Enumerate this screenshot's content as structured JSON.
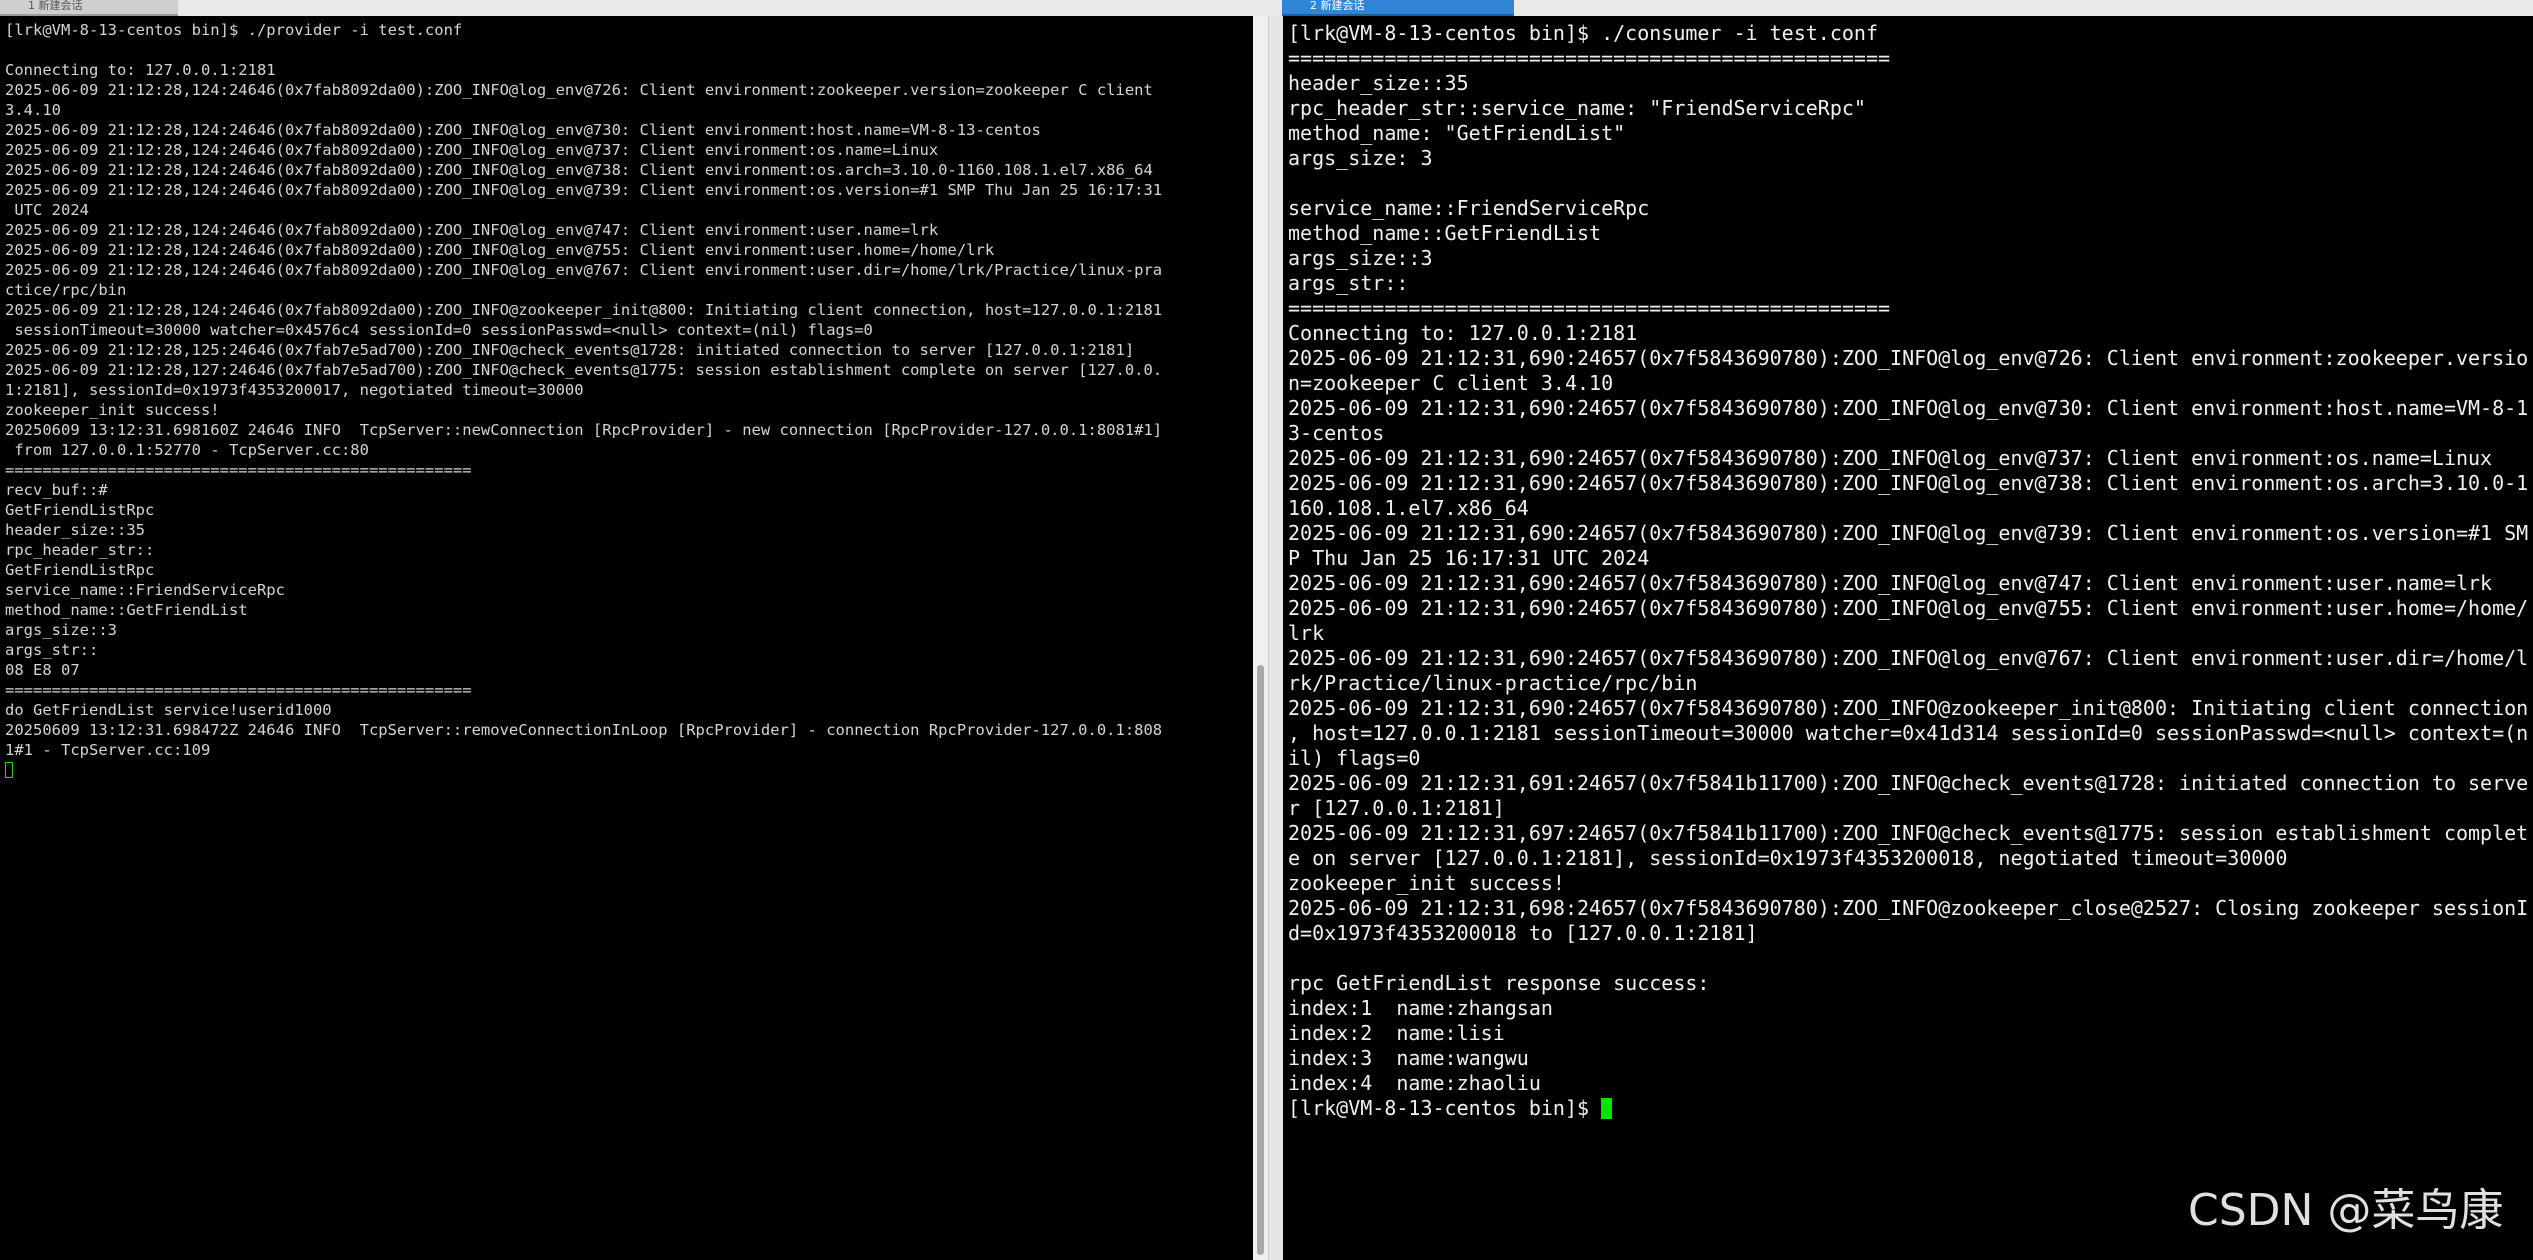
{
  "tabs": [
    {
      "label": "1 新建会话"
    },
    {
      "label": "2 新建会话"
    }
  ],
  "left_terminal": {
    "prompt_command": "[lrk@VM-8-13-centos bin]$ ./provider -i test.conf",
    "lines": [
      " ",
      "Connecting to: 127.0.0.1:2181",
      "2025-06-09 21:12:28,124:24646(0x7fab8092da00):ZOO_INFO@log_env@726: Client environment:zookeeper.version=zookeeper C client",
      "3.4.10",
      "2025-06-09 21:12:28,124:24646(0x7fab8092da00):ZOO_INFO@log_env@730: Client environment:host.name=VM-8-13-centos",
      "2025-06-09 21:12:28,124:24646(0x7fab8092da00):ZOO_INFO@log_env@737: Client environment:os.name=Linux",
      "2025-06-09 21:12:28,124:24646(0x7fab8092da00):ZOO_INFO@log_env@738: Client environment:os.arch=3.10.0-1160.108.1.el7.x86_64",
      "2025-06-09 21:12:28,124:24646(0x7fab8092da00):ZOO_INFO@log_env@739: Client environment:os.version=#1 SMP Thu Jan 25 16:17:31",
      " UTC 2024",
      "2025-06-09 21:12:28,124:24646(0x7fab8092da00):ZOO_INFO@log_env@747: Client environment:user.name=lrk",
      "2025-06-09 21:12:28,124:24646(0x7fab8092da00):ZOO_INFO@log_env@755: Client environment:user.home=/home/lrk",
      "2025-06-09 21:12:28,124:24646(0x7fab8092da00):ZOO_INFO@log_env@767: Client environment:user.dir=/home/lrk/Practice/linux-pra",
      "ctice/rpc/bin",
      "2025-06-09 21:12:28,124:24646(0x7fab8092da00):ZOO_INFO@zookeeper_init@800: Initiating client connection, host=127.0.0.1:2181",
      " sessionTimeout=30000 watcher=0x4576c4 sessionId=0 sessionPasswd=<null> context=(nil) flags=0",
      "2025-06-09 21:12:28,125:24646(0x7fab7e5ad700):ZOO_INFO@check_events@1728: initiated connection to server [127.0.0.1:2181]",
      "2025-06-09 21:12:28,127:24646(0x7fab7e5ad700):ZOO_INFO@check_events@1775: session establishment complete on server [127.0.0.",
      "1:2181], sessionId=0x1973f4353200017, negotiated timeout=30000",
      "zookeeper_init success!",
      "20250609 13:12:31.698160Z 24646 INFO  TcpServer::newConnection [RpcProvider] - new connection [RpcProvider-127.0.0.1:8081#1]",
      " from 127.0.0.1:52770 - TcpServer.cc:80",
      "==================================================",
      "recv_buf::#",
      "GetFriendListRpc",
      "header_size::35",
      "rpc_header_str::",
      "GetFriendListRpc",
      "service_name::FriendServiceRpc",
      "method_name::GetFriendList",
      "args_size::3",
      "args_str::",
      "08 E8 07",
      "==================================================",
      "do GetFriendList service!userid1000",
      "20250609 13:12:31.698472Z 24646 INFO  TcpServer::removeConnectionInLoop [RpcProvider] - connection RpcProvider-127.0.0.1:808",
      "1#1 - TcpServer.cc:109"
    ]
  },
  "right_terminal": {
    "prompt_command": "[lrk@VM-8-13-centos bin]$ ./consumer -i test.conf",
    "lines": [
      "==================================================",
      "header_size::35",
      "rpc_header_str::service_name: \"FriendServiceRpc\"",
      "method_name: \"GetFriendList\"",
      "args_size: 3",
      "",
      "service_name::FriendServiceRpc",
      "method_name::GetFriendList",
      "args_size::3",
      "args_str::",
      "==================================================",
      "Connecting to: 127.0.0.1:2181",
      "2025-06-09 21:12:31,690:24657(0x7f5843690780):ZOO_INFO@log_env@726: Client environment:zookeeper.versio",
      "n=zookeeper C client 3.4.10",
      "2025-06-09 21:12:31,690:24657(0x7f5843690780):ZOO_INFO@log_env@730: Client environment:host.name=VM-8-1",
      "3-centos",
      "2025-06-09 21:12:31,690:24657(0x7f5843690780):ZOO_INFO@log_env@737: Client environment:os.name=Linux",
      "2025-06-09 21:12:31,690:24657(0x7f5843690780):ZOO_INFO@log_env@738: Client environment:os.arch=3.10.0-1",
      "160.108.1.el7.x86_64",
      "2025-06-09 21:12:31,690:24657(0x7f5843690780):ZOO_INFO@log_env@739: Client environment:os.version=#1 SM",
      "P Thu Jan 25 16:17:31 UTC 2024",
      "2025-06-09 21:12:31,690:24657(0x7f5843690780):ZOO_INFO@log_env@747: Client environment:user.name=lrk",
      "2025-06-09 21:12:31,690:24657(0x7f5843690780):ZOO_INFO@log_env@755: Client environment:user.home=/home/",
      "lrk",
      "2025-06-09 21:12:31,690:24657(0x7f5843690780):ZOO_INFO@log_env@767: Client environment:user.dir=/home/l",
      "rk/Practice/linux-practice/rpc/bin",
      "2025-06-09 21:12:31,690:24657(0x7f5843690780):ZOO_INFO@zookeeper_init@800: Initiating client connection",
      ", host=127.0.0.1:2181 sessionTimeout=30000 watcher=0x41d314 sessionId=0 sessionPasswd=<null> context=(n",
      "il) flags=0",
      "2025-06-09 21:12:31,691:24657(0x7f5841b11700):ZOO_INFO@check_events@1728: initiated connection to serve",
      "r [127.0.0.1:2181]",
      "2025-06-09 21:12:31,697:24657(0x7f5841b11700):ZOO_INFO@check_events@1775: session establishment complet",
      "e on server [127.0.0.1:2181], sessionId=0x1973f4353200018, negotiated timeout=30000",
      "zookeeper_init success!",
      "2025-06-09 21:12:31,698:24657(0x7f5843690780):ZOO_INFO@zookeeper_close@2527: Closing zookeeper sessionI",
      "d=0x1973f4353200018 to [127.0.0.1:2181]",
      "",
      "rpc GetFriendList response success:",
      "index:1  name:zhangsan",
      "index:2  name:lisi",
      "index:3  name:wangwu",
      "index:4  name:zhaoliu"
    ],
    "final_prompt": "[lrk@VM-8-13-centos bin]$ "
  },
  "watermark": "CSDN @菜鸟康",
  "colors": {
    "terminal_bg": "#000000",
    "left_text": "#d4d4d4",
    "right_text": "#f0f0f0",
    "cursor": "#00e600",
    "active_tab": "#2f86d6"
  }
}
